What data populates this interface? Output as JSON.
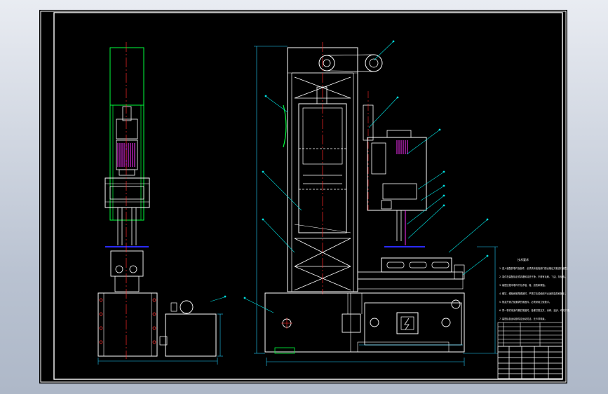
{
  "viewer": {
    "background_gradient": [
      "#e9ecf2",
      "#aeb8c8"
    ],
    "paper_color": "#000000",
    "frame_color": "#ffffff"
  },
  "drawing": {
    "layer_colors": {
      "outline": "#ffffff",
      "centerline": "#ff2a2a",
      "dimension": "#20d0ff",
      "motor_body": "#00ff3c",
      "hatch": "#ff30ff",
      "hidden": "#2a2aff",
      "leader": "#00e0e0"
    },
    "tech_notes": {
      "title": "技术要求",
      "lines": [
        "1. 进入装配的零件及部件，必须具有检验部门的合格证方能进行装配。",
        "2. 零件在装配前必须清理和清洗干净，不得有毛刺、飞边、氧化皮。",
        "3. 装配过程中零件不允许磕、碰、划伤和锈蚀。",
        "4. 螺钉、螺栓和螺母紧固时，严禁打击或使用不合适的旋具和扳手。",
        "5. 规定拧紧力矩要求的紧固件，必须采用力矩扳手。",
        "6. 同一零件用多件螺钉紧固时，各螺钉需交叉、对称、逐步、均匀拧紧。",
        "7. 装配后各运动部件应运动灵活，无卡滞现象。"
      ]
    }
  }
}
